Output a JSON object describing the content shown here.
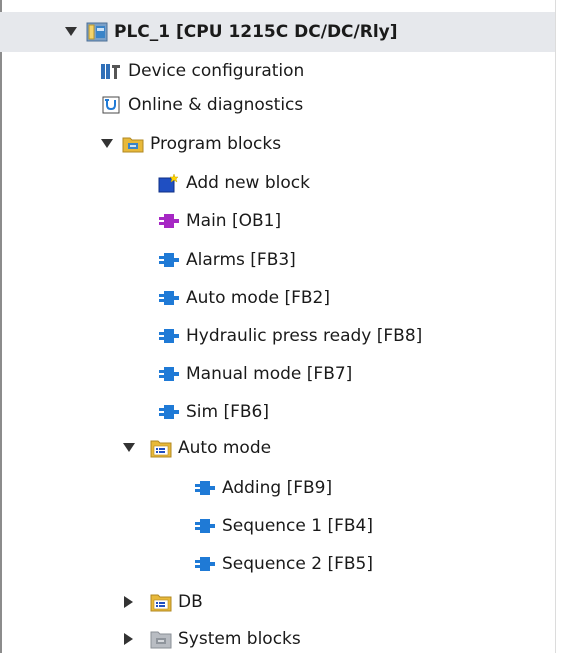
{
  "tree": {
    "root": {
      "label": "PLC_1 [CPU 1215C DC/DC/Rly]"
    },
    "device_configuration": {
      "label": "Device configuration"
    },
    "online_diagnostics": {
      "label": "Online & diagnostics"
    },
    "program_blocks": {
      "label": "Program blocks",
      "items": [
        {
          "label": "Add new block"
        },
        {
          "label": "Main [OB1]"
        },
        {
          "label": "Alarms [FB3]"
        },
        {
          "label": "Auto mode [FB2]"
        },
        {
          "label": "Hydraulic press ready [FB8]"
        },
        {
          "label": "Manual mode [FB7]"
        },
        {
          "label": "Sim [FB6]"
        }
      ],
      "auto_mode_folder": {
        "label": "Auto mode",
        "items": [
          {
            "label": "Adding [FB9]"
          },
          {
            "label": "Sequence 1 [FB4]"
          },
          {
            "label": "Sequence 2 [FB5]"
          }
        ]
      },
      "db_folder": {
        "label": "DB"
      },
      "system_blocks": {
        "label": "System blocks"
      }
    }
  },
  "colors": {
    "selection": "#e6e8ec",
    "fb_block": "#1f7ad6",
    "ob_block": "#a628c4",
    "folder": "#e8b93a",
    "arrow": "#333333"
  },
  "icons": {
    "plc": "plc-device-icon",
    "device_config": "device-configuration-icon",
    "online": "online-diagnostics-icon",
    "program_folder": "program-blocks-folder-icon",
    "add_block": "add-new-block-icon",
    "ob": "ob-block-icon",
    "fb": "fb-block-icon",
    "group_folder": "group-folder-icon",
    "system_folder": "system-blocks-folder-icon"
  }
}
